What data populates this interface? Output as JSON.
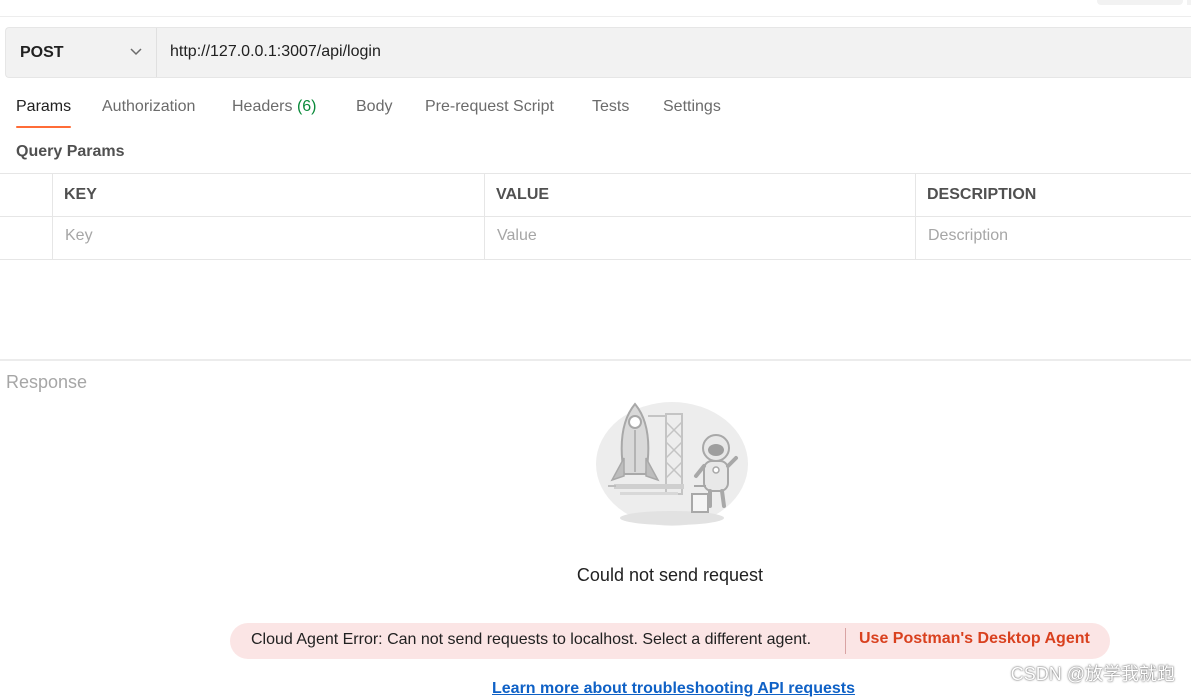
{
  "request": {
    "method": "POST",
    "url": "http://127.0.0.1:3007/api/login"
  },
  "tabs": [
    {
      "label": "Params",
      "active": true
    },
    {
      "label": "Authorization"
    },
    {
      "label": "Headers",
      "count": "(6)"
    },
    {
      "label": "Body"
    },
    {
      "label": "Pre-request Script"
    },
    {
      "label": "Tests"
    },
    {
      "label": "Settings"
    }
  ],
  "query_params": {
    "title": "Query Params",
    "columns": [
      "KEY",
      "VALUE",
      "DESCRIPTION"
    ],
    "placeholders": [
      "Key",
      "Value",
      "Description"
    ]
  },
  "response": {
    "label": "Response",
    "error_title": "Could not send request",
    "error_message": "Cloud Agent Error: Can not send requests to localhost. Select a different agent.",
    "agent_link": "Use Postman's Desktop Agent",
    "learn_more": "Learn more about troubleshooting API requests"
  },
  "watermark": "CSDN @放学我就跑",
  "colors": {
    "accent": "#ff6c37",
    "count_green": "#0a8a3a",
    "error_bg": "#fbe5e5",
    "error_link": "#d9411f",
    "link_blue": "#0f61c6"
  }
}
